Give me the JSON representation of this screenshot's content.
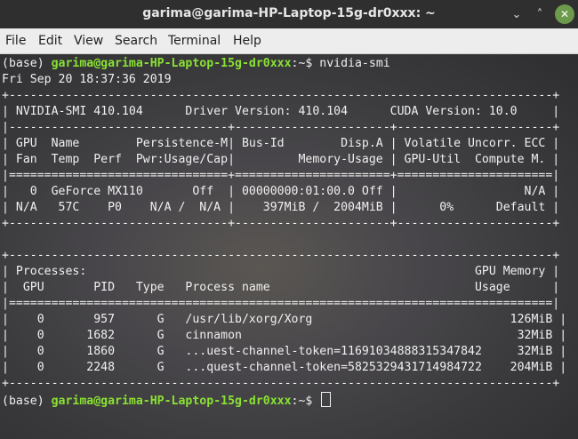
{
  "window": {
    "title": "garima@garima-HP-Laptop-15g-dr0xxx: ~",
    "minimize_glyph": "⌄",
    "maximize_glyph": "˄",
    "close_glyph": "✕"
  },
  "menu": [
    "File",
    "Edit",
    "View",
    "Search",
    "Terminal",
    "Help"
  ],
  "prompt": {
    "env": "(base) ",
    "userhost": "garima@garima-HP-Laptop-15g-dr0xxx",
    "suffix": ":~$ "
  },
  "command": "nvidia-smi",
  "lines": [
    "Fri Sep 20 18:37:36 2019",
    "+-----------------------------------------------------------------------------+",
    "| NVIDIA-SMI 410.104      Driver Version: 410.104      CUDA Version: 10.0     |",
    "|-------------------------------+----------------------+----------------------+",
    "| GPU  Name        Persistence-M| Bus-Id        Disp.A | Volatile Uncorr. ECC |",
    "| Fan  Temp  Perf  Pwr:Usage/Cap|         Memory-Usage | GPU-Util  Compute M. |",
    "|===============================+======================+======================|",
    "|   0  GeForce MX110       Off  | 00000000:01:00.0 Off |                  N/A |",
    "| N/A   57C    P0    N/A /  N/A |    397MiB /  2004MiB |      0%      Default |",
    "+-------------------------------+----------------------+----------------------+",
    "",
    "+-----------------------------------------------------------------------------+",
    "| Processes:                                                       GPU Memory |",
    "|  GPU       PID   Type   Process name                             Usage      |",
    "|=============================================================================|",
    "|    0       957      G   /usr/lib/xorg/Xorg                            126MiB |",
    "|    0      1682      G   cinnamon                                       32MiB |",
    "|    0      1860      G   ...uest-channel-token=11691034888315347842     32MiB |",
    "|    0      2248      G   ...quest-channel-token=5825329431714984722    204MiB |",
    "+-----------------------------------------------------------------------------+"
  ]
}
